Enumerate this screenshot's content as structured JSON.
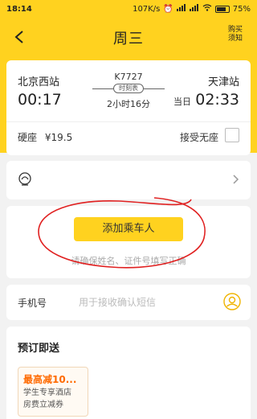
{
  "status_bar": {
    "time": "18:14",
    "network_speed": "107K/s",
    "battery": "75%"
  },
  "nav": {
    "title": "周三",
    "right_line1": "购买",
    "right_line2": "须知"
  },
  "trip": {
    "from_station": "北京西站",
    "depart_time": "00:17",
    "train_no": "K7727",
    "schedule_label": "时刻表",
    "duration": "2小时16分",
    "to_station": "天津站",
    "arrive_prefix": "当日",
    "arrive_time": "02:33",
    "seat_type": "硬座",
    "price": "¥19.5",
    "accept_no_seat": "接受无座"
  },
  "passenger": {
    "add_button": "添加乘车人",
    "hint": "请确保姓名、证件号填写正确"
  },
  "phone": {
    "label": "手机号",
    "placeholder": "用于接收确认短信"
  },
  "promo": {
    "title": "预订即送",
    "coupon_headline": "最高减10...",
    "coupon_line1": "学生专享酒店",
    "coupon_line2": "房费立减券"
  },
  "colors": {
    "brand_yellow": "#ffd21f",
    "annotation_red": "#e02020",
    "coupon_orange": "#ff6a00"
  }
}
